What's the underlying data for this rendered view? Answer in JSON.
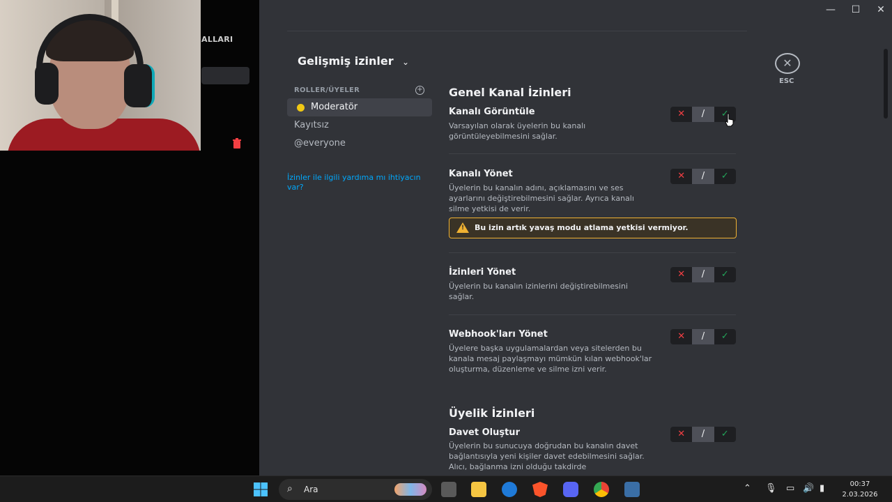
{
  "window": {
    "minimize": "—",
    "maximize": "☐",
    "close": "✕"
  },
  "left_panel": {
    "category_label": "ALLARI"
  },
  "header": {
    "title": "Gelişmiş izinler"
  },
  "roles": {
    "label": "ROLLER/ÜYELER",
    "items": [
      {
        "label": "Moderatör",
        "color": "#f0c814"
      },
      {
        "label": "Kayıtsız"
      },
      {
        "label": "@everyone"
      }
    ],
    "help_link": "İzinler ile ilgili yardıma mı ihtiyacın var?"
  },
  "esc": {
    "label": "ESC"
  },
  "sections": {
    "general": {
      "title": "Genel Kanal İzinleri",
      "perms": [
        {
          "title": "Kanalı Görüntüle",
          "desc": "Varsayılan olarak üyelerin bu kanalı görüntüleyebilmesini sağlar."
        },
        {
          "title": "Kanalı Yönet",
          "desc": "Üyelerin bu kanalın adını, açıklamasını ve ses ayarlarını değiştirebilmesini sağlar. Ayrıca kanalı silme yetkisi de verir.",
          "warning": "Bu izin artık yavaş modu atlama yetkisi vermiyor."
        },
        {
          "title": "İzinleri Yönet",
          "desc": "Üyelerin bu kanalın izinlerini değiştirebilmesini sağlar."
        },
        {
          "title": "Webhook'ları Yönet",
          "desc": "Üyelere başka uygulamalardan veya sitelerden bu kanala mesaj paylaşmayı mümkün kılan webhook'lar oluşturma, düzenleme ve silme izni verir."
        }
      ]
    },
    "membership": {
      "title": "Üyelik İzinleri",
      "perms": [
        {
          "title": "Davet Oluştur",
          "desc": "Üyelerin bu sunucuya doğrudan bu kanalın davet bağlantısıyla yeni kişiler davet edebilmesini sağlar. Alıcı, bağlanma izni olduğu takdirde"
        }
      ]
    }
  },
  "toggle": {
    "deny": "✕",
    "neutral": "/",
    "allow": "✓"
  },
  "colors": {
    "deny": "#f23f43",
    "allow": "#23a55a",
    "warning": "#f0b232",
    "link": "#00a8fc"
  },
  "taskbar": {
    "search_placeholder": "Ara",
    "time": "00:37",
    "date": "2.03.2026",
    "icons": [
      "windows-start-icon",
      "task-view-icon",
      "file-explorer-icon",
      "mail-icon",
      "brave-browser-icon",
      "discord-icon",
      "chrome-icon",
      "calculator-icon"
    ],
    "tray_icons": [
      "chevron-up-icon",
      "microphone-icon",
      "display-icon",
      "volume-icon",
      "battery-icon"
    ]
  }
}
